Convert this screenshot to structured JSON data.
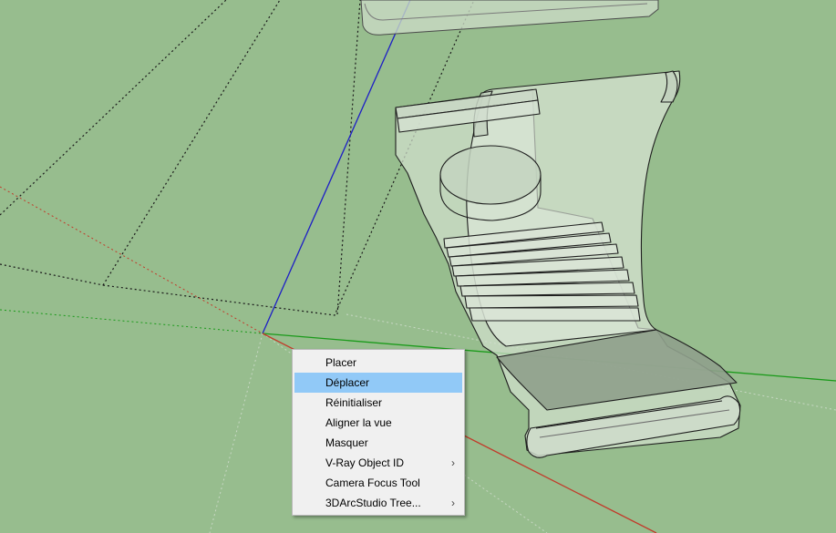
{
  "context_menu": {
    "items": [
      {
        "label": "Placer",
        "highlighted": false,
        "submenu": false
      },
      {
        "label": "Déplacer",
        "highlighted": true,
        "submenu": false
      },
      {
        "label": "Réinitialiser",
        "highlighted": false,
        "submenu": false
      },
      {
        "label": "Aligner la vue",
        "highlighted": false,
        "submenu": false
      },
      {
        "label": "Masquer",
        "highlighted": false,
        "submenu": false
      },
      {
        "label": "V-Ray Object ID",
        "highlighted": false,
        "submenu": true
      },
      {
        "label": "Camera Focus Tool",
        "highlighted": false,
        "submenu": false
      },
      {
        "label": "3DArcStudio Tree...",
        "highlighted": false,
        "submenu": true
      }
    ],
    "submenu_arrow": "›"
  },
  "colors": {
    "background": "#97bd8e",
    "highlight": "#91c9f7",
    "axis_red": "#c23a2a",
    "axis_green": "#1a9a1a",
    "axis_blue": "#1d1ec6"
  }
}
